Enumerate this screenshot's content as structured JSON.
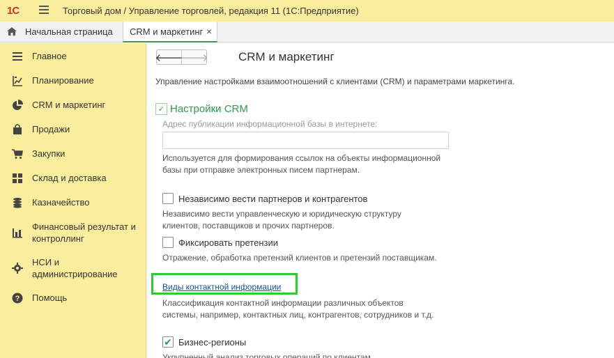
{
  "titlebar": {
    "logo": "1С",
    "title": "Торговый дом / Управление торговлей, редакция 11  (1С:Предприятие)"
  },
  "tabs": {
    "home_label": "Начальная страница",
    "active_label": "CRM и маркетинг",
    "close_glyph": "×"
  },
  "sidebar": {
    "items": [
      {
        "label": "Главное",
        "icon": "hamburger-icon"
      },
      {
        "label": "Планирование",
        "icon": "planning-icon"
      },
      {
        "label": "CRM и маркетинг",
        "icon": "pie-chart-icon"
      },
      {
        "label": "Продажи",
        "icon": "shopping-bag-icon"
      },
      {
        "label": "Закупки",
        "icon": "cart-icon"
      },
      {
        "label": "Склад и доставка",
        "icon": "warehouse-icon"
      },
      {
        "label": "Казначейство",
        "icon": "coins-icon"
      },
      {
        "label": "Финансовый результат и контроллинг",
        "icon": "bar-chart-icon"
      },
      {
        "label": "НСИ и администрирование",
        "icon": "gear-icon"
      },
      {
        "label": "Помощь",
        "icon": "help-icon"
      }
    ]
  },
  "main": {
    "back_glyph": "🡐",
    "forward_glyph": "🡒",
    "title": "CRM и маркетинг",
    "description": "Управление настройками взаимоотношений с клиентами (CRM) и параметрами маркетинга.",
    "section_title": "Настройки CRM",
    "section_toggle": "✓",
    "address_label": "Адрес публикации информационной базы в интернете:",
    "address_value": "",
    "address_hint": "Используется для формирования ссылок на объекты информационной базы при отправке электронных писем партнерам.",
    "partners_checkbox_label": "Независимо вести партнеров и контрагентов",
    "partners_hint": "Независимо вести управленческую и юридическую структуру клиентов, поставщиков и прочих партнеров.",
    "claims_checkbox_label": "Фиксировать претензии",
    "claims_hint": "Отражение, обработка претензий клиентов и претензий поставщикам.",
    "contact_link": "Виды контактной информации",
    "contact_hint": "Классификация контактной информации различных объектов системы, например, контактных лиц, контрагентов, сотрудников и т.д.",
    "regions_checkbox_label": "Бизнес-регионы",
    "regions_checked_glyph": "✔",
    "regions_hint": "Укрупненный анализ торговых операций по клиентам"
  }
}
